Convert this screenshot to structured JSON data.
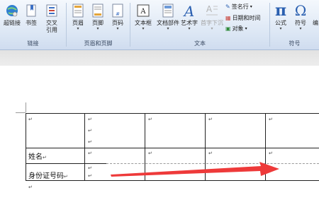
{
  "ribbon": {
    "groups": [
      {
        "label": "链接"
      },
      {
        "label": "页眉和页脚"
      },
      {
        "label": "文本"
      },
      {
        "label": "符号"
      }
    ],
    "buttons": {
      "hyperlink": "超链接",
      "bookmark": "书签",
      "cross_ref": "交叉\n引用",
      "header": "页眉",
      "footer": "页脚",
      "page_number": "页码",
      "textbox": "文本框",
      "quick_parts": "文档部件",
      "wordart": "艺术字",
      "dropcap": "首字下沉",
      "signature_line": "签名行",
      "date_time": "日期和时间",
      "object": "对象",
      "equation": "公式",
      "symbol": "符号",
      "edge": "编"
    },
    "icons": {
      "hyperlink": "globe-link-icon",
      "bookmark": "bookmark-icon",
      "cross_ref": "cross-reference-icon",
      "header": "header-icon",
      "footer": "footer-icon",
      "page_number": "page-number-icon",
      "textbox": "textbox-icon",
      "quick_parts": "quick-parts-icon",
      "wordart": "wordart-icon",
      "dropcap": "dropcap-icon",
      "equation": "pi-icon",
      "symbol": "omega-icon"
    }
  },
  "document": {
    "table": {
      "row_labels": [
        "",
        "姓名",
        "身份证号码"
      ],
      "paragraph_mark": "↵"
    },
    "arrow_color": "#ee3a3a"
  }
}
